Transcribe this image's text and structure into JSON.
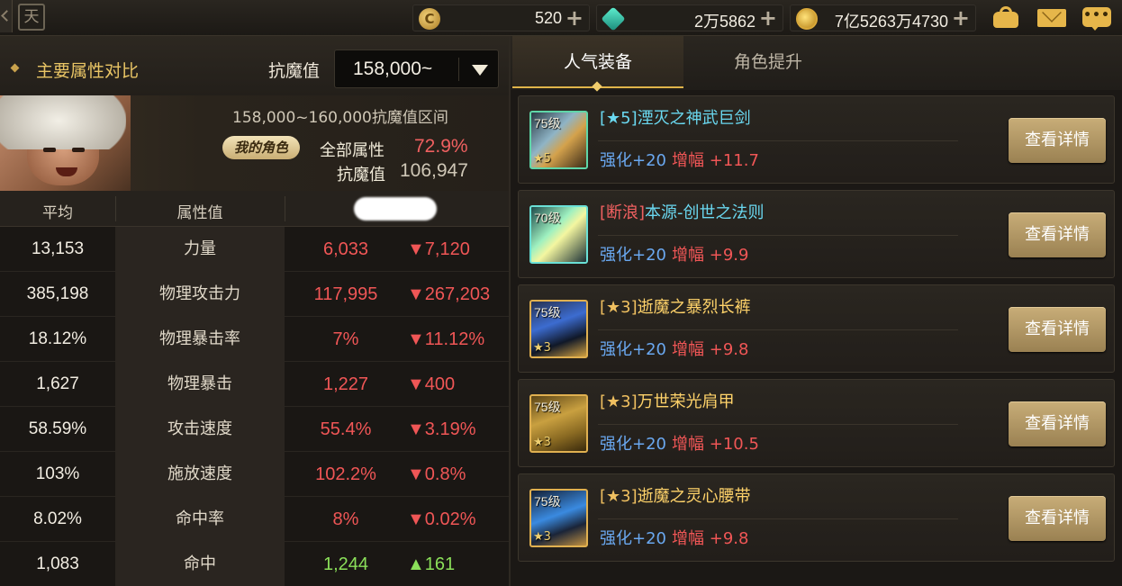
{
  "topbar": {
    "currencies": [
      {
        "icon": "coin-c-icon",
        "value": "520"
      },
      {
        "icon": "gem-icon",
        "value": "2万5862"
      },
      {
        "icon": "gold-coin-icon",
        "value": "7亿5263万4730"
      }
    ],
    "calendar_glyph": "天",
    "plus_glyph": "+",
    "chat_glyph": "•••"
  },
  "left": {
    "section_title": "主要属性对比",
    "resist_label": "抗魔值",
    "resist_select_value": "158,000~",
    "range_text": "158,000~160,000抗魔值区间",
    "mychar_badge": "我的角色",
    "allattr_label": "全部属性",
    "allattr_value": "72.9%",
    "mychar_resist_label": "抗魔值",
    "mychar_resist_value": "106,947",
    "table_headers": {
      "avg": "平均",
      "attr": "属性值"
    },
    "rows": [
      {
        "avg": "13,153",
        "name": "力量",
        "mine": "6,033",
        "diff": "▼7,120",
        "trend": "down"
      },
      {
        "avg": "385,198",
        "name": "物理攻击力",
        "mine": "117,995",
        "diff": "▼267,203",
        "trend": "down"
      },
      {
        "avg": "18.12%",
        "name": "物理暴击率",
        "mine": "7%",
        "diff": "▼11.12%",
        "trend": "down"
      },
      {
        "avg": "1,627",
        "name": "物理暴击",
        "mine": "1,227",
        "diff": "▼400",
        "trend": "down"
      },
      {
        "avg": "58.59%",
        "name": "攻击速度",
        "mine": "55.4%",
        "diff": "▼3.19%",
        "trend": "down"
      },
      {
        "avg": "103%",
        "name": "施放速度",
        "mine": "102.2%",
        "diff": "▼0.8%",
        "trend": "down"
      },
      {
        "avg": "8.02%",
        "name": "命中率",
        "mine": "8%",
        "diff": "▼0.02%",
        "trend": "down"
      },
      {
        "avg": "1,083",
        "name": "命中",
        "mine": "1,244",
        "diff": "▲161",
        "trend": "up"
      }
    ]
  },
  "right": {
    "tabs": [
      {
        "label": "人气装备",
        "active": true
      },
      {
        "label": "角色提升",
        "active": false
      }
    ],
    "equipment": [
      {
        "level": "75级",
        "star": "★5",
        "tag": "[★5]",
        "name": "湮灭之神武巨剑",
        "enhance": "强化+20",
        "amp_label": "增幅",
        "amp": "+11.7",
        "button": "查看详情"
      },
      {
        "level": "70级",
        "star": "",
        "tag": "[断浪]",
        "name": "本源-创世之法则",
        "enhance": "强化+20",
        "amp_label": "增幅",
        "amp": "+9.9",
        "button": "查看详情"
      },
      {
        "level": "75级",
        "star": "★3",
        "tag": "[★3]",
        "name": "逝魔之暴烈长裤",
        "enhance": "强化+20",
        "amp_label": "增幅",
        "amp": "+9.8",
        "button": "查看详情"
      },
      {
        "level": "75级",
        "star": "★3",
        "tag": "[★3]",
        "name": "万世荣光肩甲",
        "enhance": "强化+20",
        "amp_label": "增幅",
        "amp": "+10.5",
        "button": "查看详情"
      },
      {
        "level": "75级",
        "star": "★3",
        "tag": "[★3]",
        "name": "逝魔之灵心腰带",
        "enhance": "强化+20",
        "amp_label": "增幅",
        "amp": "+9.8",
        "button": "查看详情"
      }
    ]
  }
}
